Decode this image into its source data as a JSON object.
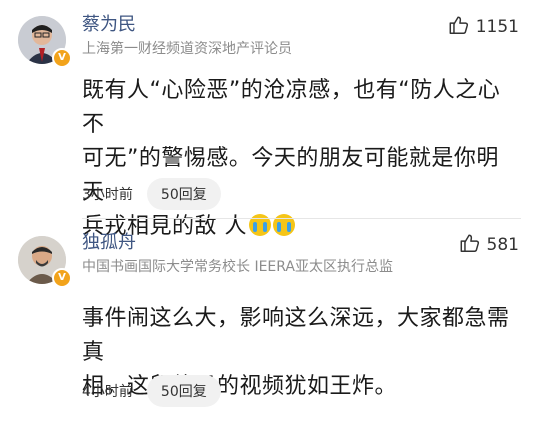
{
  "comments": [
    {
      "author": "蔡为民",
      "title": "上海第一财经频道资深地产评论员",
      "likes": "1151",
      "lines": [
        "既有人“心险恶”的沧凉感，也有“防人之心不",
        "可无”的警惕感。今天的朋友可能就是你明天",
        "兵戎相見的敌 人"
      ],
      "emojis": [
        "crying-emoji",
        "crying-emoji"
      ],
      "time": "3小时前",
      "reply_label": "50回复"
    },
    {
      "author": "独孤舟",
      "title": "中国书画国际大学常务校长 IEERA亚太区执行总监",
      "likes": "581",
      "lines": [
        "事件闹这么大，影响这么深远，大家都急需真",
        "相。这段偷录的视频犹如王炸。"
      ],
      "time": "4小时前",
      "reply_label": "50回复"
    }
  ],
  "colors": {
    "author_name": "#3f5682",
    "secondary_text": "#8c8c8c",
    "verified_badge": "#f2a31b",
    "reply_bg": "#f1f1f1"
  }
}
